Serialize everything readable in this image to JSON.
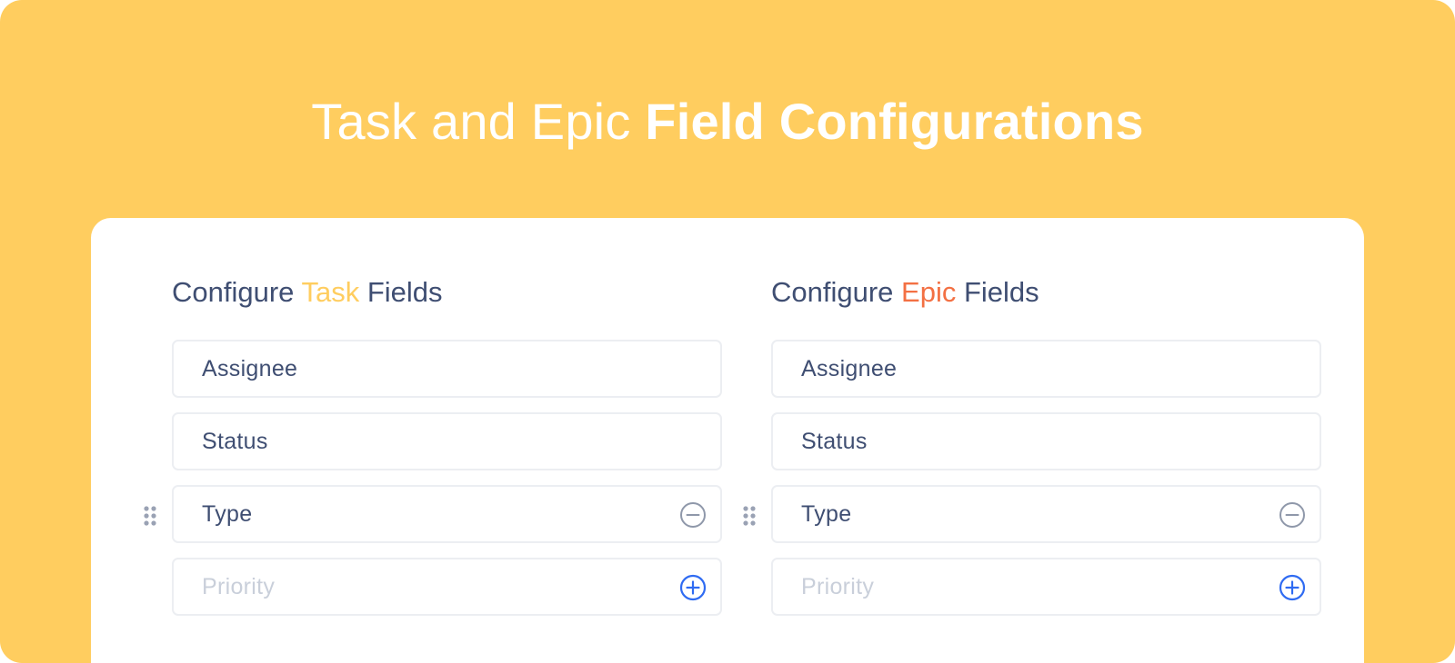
{
  "header": {
    "title_light": "Task and Epic",
    "title_bold": "Field Configurations"
  },
  "colors": {
    "background": "#FFCD5F",
    "task_accent": "#FFCD5F",
    "epic_accent": "#F37043",
    "text": "#3F4E72",
    "placeholder": "#C9CFDA",
    "add_icon": "#2F6BF2",
    "remove_icon": "#8F98AA"
  },
  "task_panel": {
    "title_prefix": "Configure",
    "title_accent": "Task",
    "title_suffix": "Fields",
    "fields": [
      {
        "label": "Assignee"
      },
      {
        "label": "Status"
      },
      {
        "label": "Type",
        "icon": "minus-circle-icon",
        "draggable": true
      },
      {
        "label": "Priority",
        "icon": "plus-circle-icon",
        "placeholder": true
      }
    ]
  },
  "epic_panel": {
    "title_prefix": "Configure",
    "title_accent": "Epic",
    "title_suffix": "Fields",
    "fields": [
      {
        "label": "Assignee"
      },
      {
        "label": "Status"
      },
      {
        "label": "Type",
        "icon": "minus-circle-icon",
        "draggable": true
      },
      {
        "label": "Priority",
        "icon": "plus-circle-icon",
        "placeholder": true
      }
    ]
  }
}
